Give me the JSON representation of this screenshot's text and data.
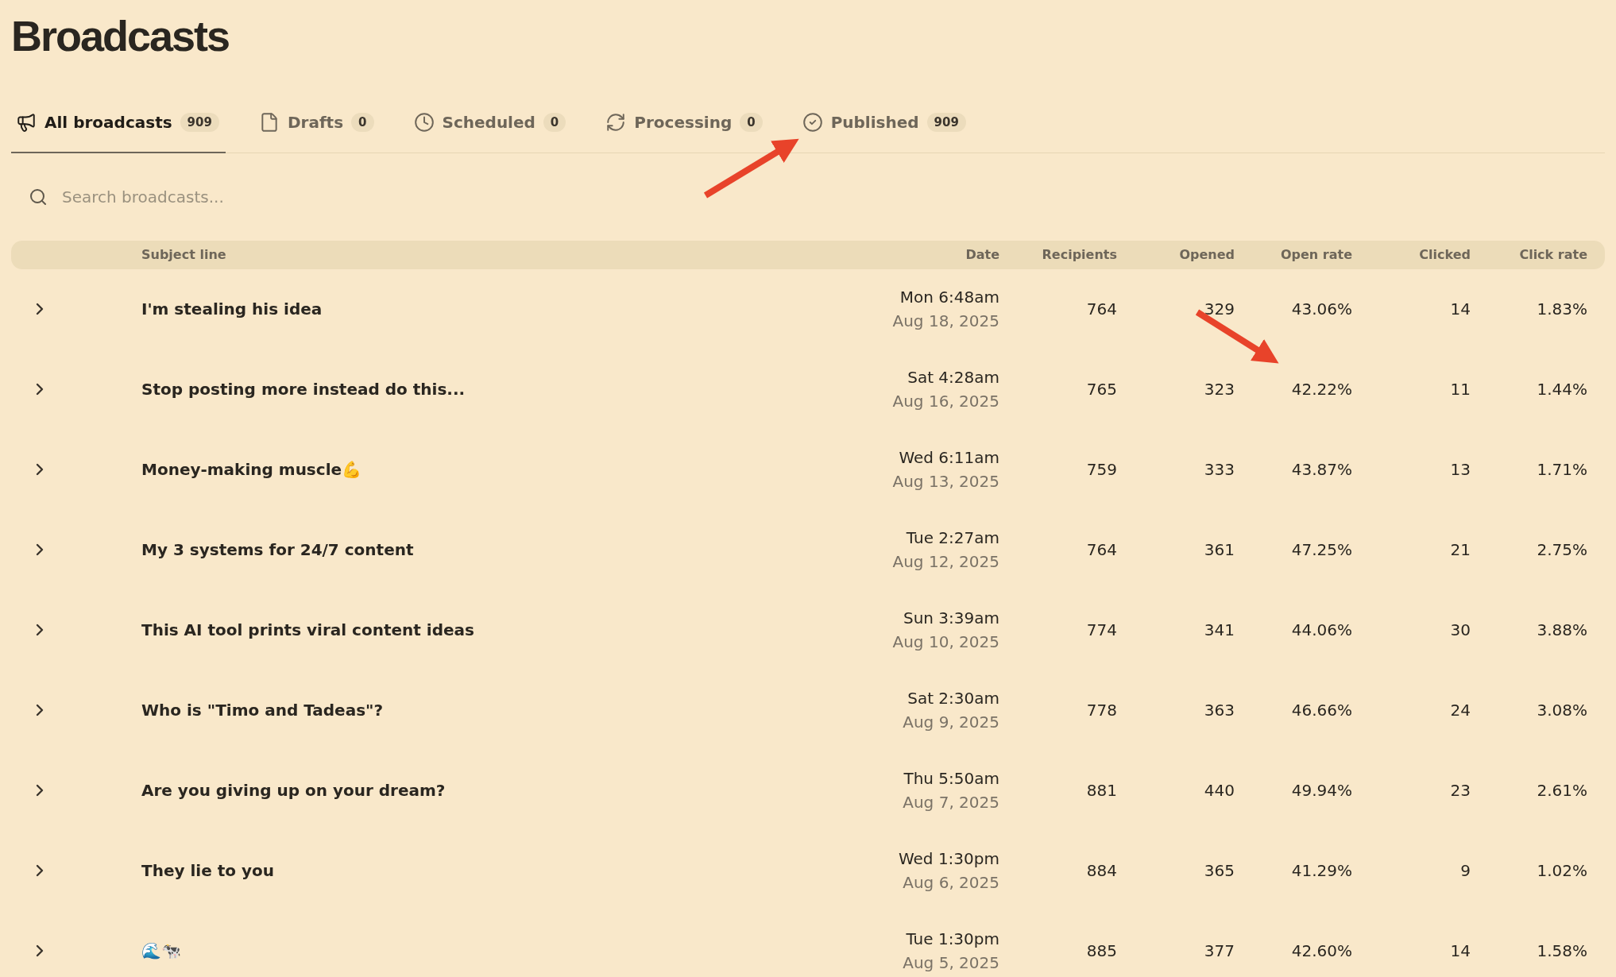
{
  "title": "Broadcasts",
  "tabs": [
    {
      "kind": "megaphone",
      "label": "All broadcasts",
      "count": "909",
      "selected": true
    },
    {
      "kind": "file",
      "label": "Drafts",
      "count": "0",
      "selected": false
    },
    {
      "kind": "clock",
      "label": "Scheduled",
      "count": "0",
      "selected": false
    },
    {
      "kind": "refresh",
      "label": "Processing",
      "count": "0",
      "selected": false
    },
    {
      "kind": "check",
      "label": "Published",
      "count": "909",
      "selected": false
    }
  ],
  "search": {
    "placeholder": "Search broadcasts..."
  },
  "table": {
    "columns": [
      "Subject line",
      "Date",
      "Recipients",
      "Opened",
      "Open rate",
      "Clicked",
      "Click rate"
    ],
    "rows": [
      {
        "subject": "I'm stealing his idea",
        "time": "Mon 6:48am",
        "date": "Aug 18, 2025",
        "recipients": "764",
        "opened": "329",
        "open_rate": "43.06%",
        "clicked": "14",
        "click_rate": "1.83%"
      },
      {
        "subject": "Stop posting more instead do this...",
        "time": "Sat 4:28am",
        "date": "Aug 16, 2025",
        "recipients": "765",
        "opened": "323",
        "open_rate": "42.22%",
        "clicked": "11",
        "click_rate": "1.44%"
      },
      {
        "subject": "Money-making muscle💪",
        "time": "Wed 6:11am",
        "date": "Aug 13, 2025",
        "recipients": "759",
        "opened": "333",
        "open_rate": "43.87%",
        "clicked": "13",
        "click_rate": "1.71%"
      },
      {
        "subject": "My 3 systems for 24/7 content",
        "time": "Tue 2:27am",
        "date": "Aug 12, 2025",
        "recipients": "764",
        "opened": "361",
        "open_rate": "47.25%",
        "clicked": "21",
        "click_rate": "2.75%"
      },
      {
        "subject": "This AI tool prints viral content ideas",
        "time": "Sun 3:39am",
        "date": "Aug 10, 2025",
        "recipients": "774",
        "opened": "341",
        "open_rate": "44.06%",
        "clicked": "30",
        "click_rate": "3.88%"
      },
      {
        "subject": "Who is \"Timo and Tadeas\"?",
        "time": "Sat 2:30am",
        "date": "Aug 9, 2025",
        "recipients": "778",
        "opened": "363",
        "open_rate": "46.66%",
        "clicked": "24",
        "click_rate": "3.08%"
      },
      {
        "subject": "Are you giving up on your dream?",
        "time": "Thu 5:50am",
        "date": "Aug 7, 2025",
        "recipients": "881",
        "opened": "440",
        "open_rate": "49.94%",
        "clicked": "23",
        "click_rate": "2.61%"
      },
      {
        "subject": "They lie to you",
        "time": "Wed 1:30pm",
        "date": "Aug 6, 2025",
        "recipients": "884",
        "opened": "365",
        "open_rate": "41.29%",
        "clicked": "9",
        "click_rate": "1.02%"
      },
      {
        "subject": "🌊🐄",
        "time": "Tue 1:30pm",
        "date": "Aug 5, 2025",
        "recipients": "885",
        "opened": "377",
        "open_rate": "42.60%",
        "clicked": "14",
        "click_rate": "1.58%"
      }
    ]
  }
}
